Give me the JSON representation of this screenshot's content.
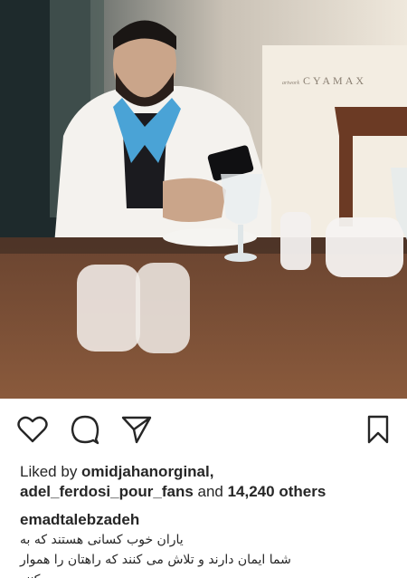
{
  "post": {
    "watermark_prefix": "artwork",
    "watermark": "CYAMAX"
  },
  "actions": {
    "like_icon": "heart-icon",
    "comment_icon": "comment-icon",
    "share_icon": "paper-plane-icon",
    "save_icon": "bookmark-icon"
  },
  "likes": {
    "prefix": "Liked by ",
    "user1": "omidjahanorginal,",
    "user2": "adel_ferdosi_pour_fans",
    "joiner": " and ",
    "count": "14,240 others"
  },
  "caption": {
    "username": "emadtalebzadeh",
    "line1": "یاران خوب کسانی هستند که به",
    "line2": "شما ایمان دارند و تلاش می کنند که راهتان را هموار",
    "line3": "-------- .... کنند"
  },
  "colors": {
    "text": "#262626",
    "background": "#ffffff"
  }
}
